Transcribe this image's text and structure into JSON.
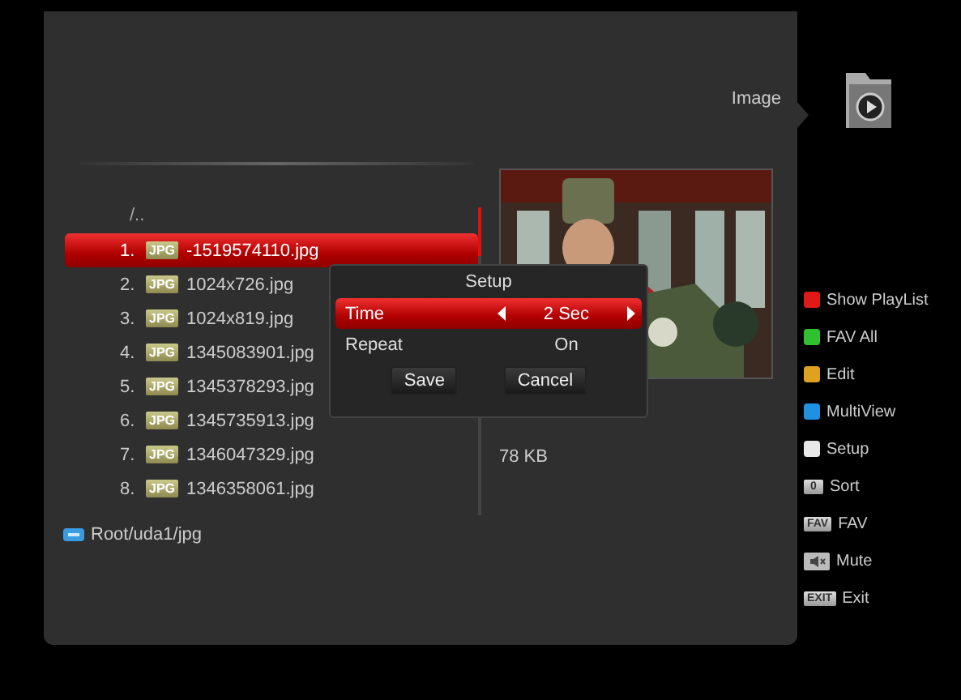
{
  "header": {
    "title": "Image"
  },
  "browser": {
    "parent": "/..",
    "files": [
      {
        "number": "1.",
        "badge": "JPG",
        "name": "-1519574110.jpg",
        "selected": true
      },
      {
        "number": "2.",
        "badge": "JPG",
        "name": "1024x726.jpg",
        "selected": false
      },
      {
        "number": "3.",
        "badge": "JPG",
        "name": "1024x819.jpg",
        "selected": false
      },
      {
        "number": "4.",
        "badge": "JPG",
        "name": "1345083901.jpg",
        "selected": false
      },
      {
        "number": "5.",
        "badge": "JPG",
        "name": "1345378293.jpg",
        "selected": false
      },
      {
        "number": "6.",
        "badge": "JPG",
        "name": "1345735913.jpg",
        "selected": false
      },
      {
        "number": "7.",
        "badge": "JPG",
        "name": "1346047329.jpg",
        "selected": false
      },
      {
        "number": "8.",
        "badge": "JPG",
        "name": "1346358061.jpg",
        "selected": false
      }
    ],
    "path": "Root/uda1/jpg"
  },
  "preview": {
    "kind": "picture",
    "size": "78 KB"
  },
  "setup_dialog": {
    "title": "Setup",
    "options": [
      {
        "label": "Time",
        "value": "2 Sec",
        "selected": true
      },
      {
        "label": "Repeat",
        "value": "On",
        "selected": false
      }
    ],
    "buttons": [
      "Save",
      "Cancel"
    ]
  },
  "legend": [
    {
      "kind": "color",
      "color": "#e01818",
      "label": "Show PlayList"
    },
    {
      "kind": "color",
      "color": "#30c030",
      "label": "FAV All"
    },
    {
      "kind": "color",
      "color": "#e0a020",
      "label": "Edit"
    },
    {
      "kind": "color",
      "color": "#2090e0",
      "label": "MultiView"
    },
    {
      "kind": "color",
      "color": "#e8e8e8",
      "label": "Setup"
    },
    {
      "kind": "key",
      "key": "0",
      "label": "Sort"
    },
    {
      "kind": "key",
      "key": "FAV",
      "label": "FAV"
    },
    {
      "kind": "mute",
      "label": "Mute"
    },
    {
      "kind": "key",
      "key": "EXIT",
      "label": "Exit"
    }
  ]
}
